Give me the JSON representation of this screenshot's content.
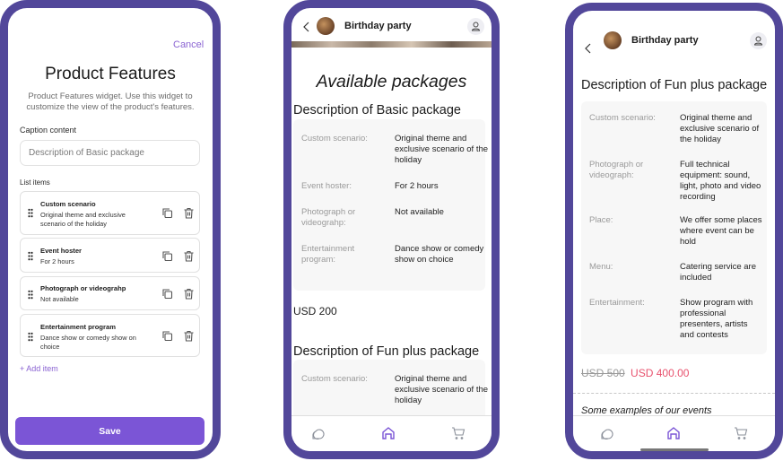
{
  "editor": {
    "cancel": "Cancel",
    "title": "Product Features",
    "description": "Product Features widget. Use this widget to customize the view of the product's features.",
    "caption_label": "Caption content",
    "caption_value": "Description of Basic package",
    "list_label": "List items",
    "items": [
      {
        "title": "Custom scenario",
        "text": "Original theme and exclusive scenario of the holiday"
      },
      {
        "title": "Event hoster",
        "text": "For 2 hours"
      },
      {
        "title": "Photograph or videograhp",
        "text": "Not available"
      },
      {
        "title": "Entertainment program",
        "text": "Dance show or comedy show on choice"
      }
    ],
    "add_item": "+ Add item",
    "save": "Save"
  },
  "preview1": {
    "header_title": "Birthday party",
    "heading": "Available packages",
    "basic_title": "Description of Basic package",
    "basic_rows": [
      {
        "label": "Custom scenario:",
        "value": "Original theme and exclusive scenario of the holiday"
      },
      {
        "label": "Event hoster:",
        "value": "For 2 hours"
      },
      {
        "label": "Photograph or videograhp:",
        "value": "Not available"
      },
      {
        "label": "Entertainment program:",
        "value": "Dance show or comedy show on choice"
      }
    ],
    "basic_price": "USD 200",
    "fun_title": "Description of Fun plus package",
    "fun_rows": [
      {
        "label": "Custom scenario:",
        "value": "Original theme and exclusive scenario of the holiday"
      }
    ]
  },
  "preview2": {
    "header_title": "Birthday party",
    "fun_title": "Description of Fun plus package",
    "fun_rows": [
      {
        "label": "Custom scenario:",
        "value": "Original theme and exclusive scenario of the holiday"
      },
      {
        "label": "Photograph or videograph:",
        "value": "Full technical equipment: sound, light, photo and video recording"
      },
      {
        "label": "Place:",
        "value": "We offer some places where event can be hold"
      },
      {
        "label": "Menu:",
        "value": "Catering service are included"
      },
      {
        "label": "Entertainment:",
        "value": "Show program with professional presenters, artists and contests"
      }
    ],
    "old_price": "USD 500",
    "new_price": "USD 400.00",
    "examples": "Some examples of our events"
  },
  "colors": {
    "frame": "#52479a",
    "accent": "#7b55d6",
    "sale": "#e8526e"
  },
  "icons": {
    "nav": [
      "chat-icon",
      "home-icon",
      "cart-icon"
    ]
  }
}
